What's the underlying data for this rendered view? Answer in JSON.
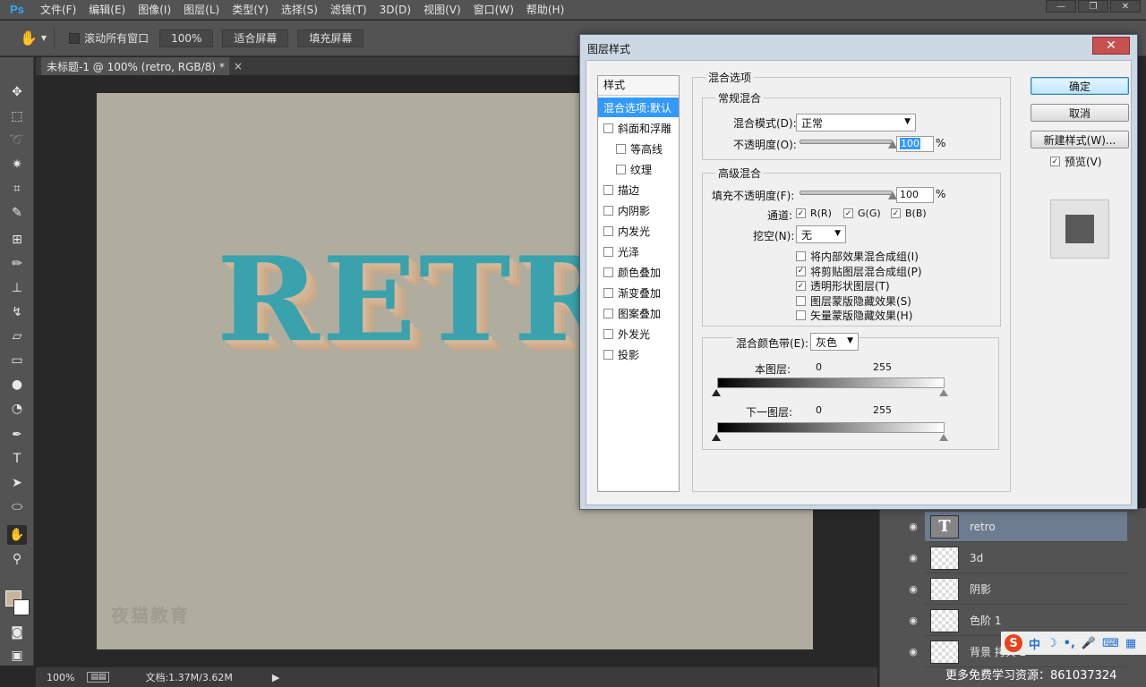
{
  "app": {
    "logo": "Ps"
  },
  "menu": [
    "文件(F)",
    "编辑(E)",
    "图像(I)",
    "图层(L)",
    "类型(Y)",
    "选择(S)",
    "滤镜(T)",
    "3D(D)",
    "视图(V)",
    "窗口(W)",
    "帮助(H)"
  ],
  "window_controls": {
    "minimize": "—",
    "restore": "❐",
    "close": "✕"
  },
  "options": {
    "scroll_all": "滚动所有窗口",
    "zoom_btn": "100%",
    "fit_screen": "适合屏幕",
    "fill_screen": "填充屏幕"
  },
  "tab": {
    "title": "未标题-1 @ 100% (retro, RGB/8) *",
    "close": "×"
  },
  "canvas": {
    "text": "RETRO",
    "watermark": "夜猫教育",
    "bg": "#b0ac9e",
    "text_color": "#3aa2ad"
  },
  "status": {
    "zoom": "100%",
    "doc": "文档:1.37M/3.62M"
  },
  "layers": [
    {
      "name": "retro",
      "thumb": "T",
      "selected": true
    },
    {
      "name": "3d",
      "thumb": "",
      "selected": false
    },
    {
      "name": "阴影",
      "thumb": "",
      "selected": false
    },
    {
      "name": "色阶 1",
      "thumb": "",
      "selected": false
    },
    {
      "name": "背景 拷贝 2",
      "thumb": "",
      "selected": false
    }
  ],
  "footer_note": "更多免费学习资源：861037324",
  "ime": {
    "logo": "S",
    "lang": "中",
    "moon": "☽",
    "mark": "•,"
  },
  "dialog": {
    "title": "图层样式",
    "close": "✕",
    "styles_header": "样式",
    "styles": [
      {
        "label": "混合选项:默认",
        "selected": true,
        "checkbox": false,
        "indent": false
      },
      {
        "label": "斜面和浮雕",
        "selected": false,
        "checkbox": true,
        "indent": false
      },
      {
        "label": "等高线",
        "selected": false,
        "checkbox": true,
        "indent": true
      },
      {
        "label": "纹理",
        "selected": false,
        "checkbox": true,
        "indent": true
      },
      {
        "label": "描边",
        "selected": false,
        "checkbox": true,
        "indent": false
      },
      {
        "label": "内阴影",
        "selected": false,
        "checkbox": true,
        "indent": false
      },
      {
        "label": "内发光",
        "selected": false,
        "checkbox": true,
        "indent": false
      },
      {
        "label": "光泽",
        "selected": false,
        "checkbox": true,
        "indent": false
      },
      {
        "label": "颜色叠加",
        "selected": false,
        "checkbox": true,
        "indent": false
      },
      {
        "label": "渐变叠加",
        "selected": false,
        "checkbox": true,
        "indent": false
      },
      {
        "label": "图案叠加",
        "selected": false,
        "checkbox": true,
        "indent": false
      },
      {
        "label": "外发光",
        "selected": false,
        "checkbox": true,
        "indent": false
      },
      {
        "label": "投影",
        "selected": false,
        "checkbox": true,
        "indent": false
      }
    ],
    "blend_options": {
      "title": "混合选项",
      "general": {
        "title": "常规混合",
        "mode_label": "混合模式(D):",
        "mode_value": "正常",
        "opacity_label": "不透明度(O):",
        "opacity_value": "100",
        "opacity_fraction": 1.0,
        "percent": "%"
      },
      "advanced": {
        "title": "高级混合",
        "fill_label": "填充不透明度(F):",
        "fill_value": "100",
        "fill_fraction": 1.0,
        "percent": "%",
        "channels_label": "通道:",
        "channels": [
          {
            "label": "R(R)",
            "checked": true
          },
          {
            "label": "G(G)",
            "checked": true
          },
          {
            "label": "B(B)",
            "checked": true
          }
        ],
        "knockout_label": "挖空(N):",
        "knockout_value": "无",
        "options": [
          {
            "label": "将内部效果混合成组(I)",
            "checked": false
          },
          {
            "label": "将剪贴图层混合成组(P)",
            "checked": true
          },
          {
            "label": "透明形状图层(T)",
            "checked": true
          },
          {
            "label": "图层蒙版隐藏效果(S)",
            "checked": false
          },
          {
            "label": "矢量蒙版隐藏效果(H)",
            "checked": false
          }
        ]
      },
      "blend_if": {
        "label": "混合颜色带(E):",
        "value": "灰色",
        "this_layer_label": "本图层:",
        "this_low": "0",
        "this_high": "255",
        "under_layer_label": "下一图层:",
        "under_low": "0",
        "under_high": "255"
      }
    },
    "buttons": {
      "ok": "确定",
      "cancel": "取消",
      "new_style": "新建样式(W)...",
      "preview": "预览(V)",
      "preview_checked": true
    },
    "check_mark": "✓"
  }
}
